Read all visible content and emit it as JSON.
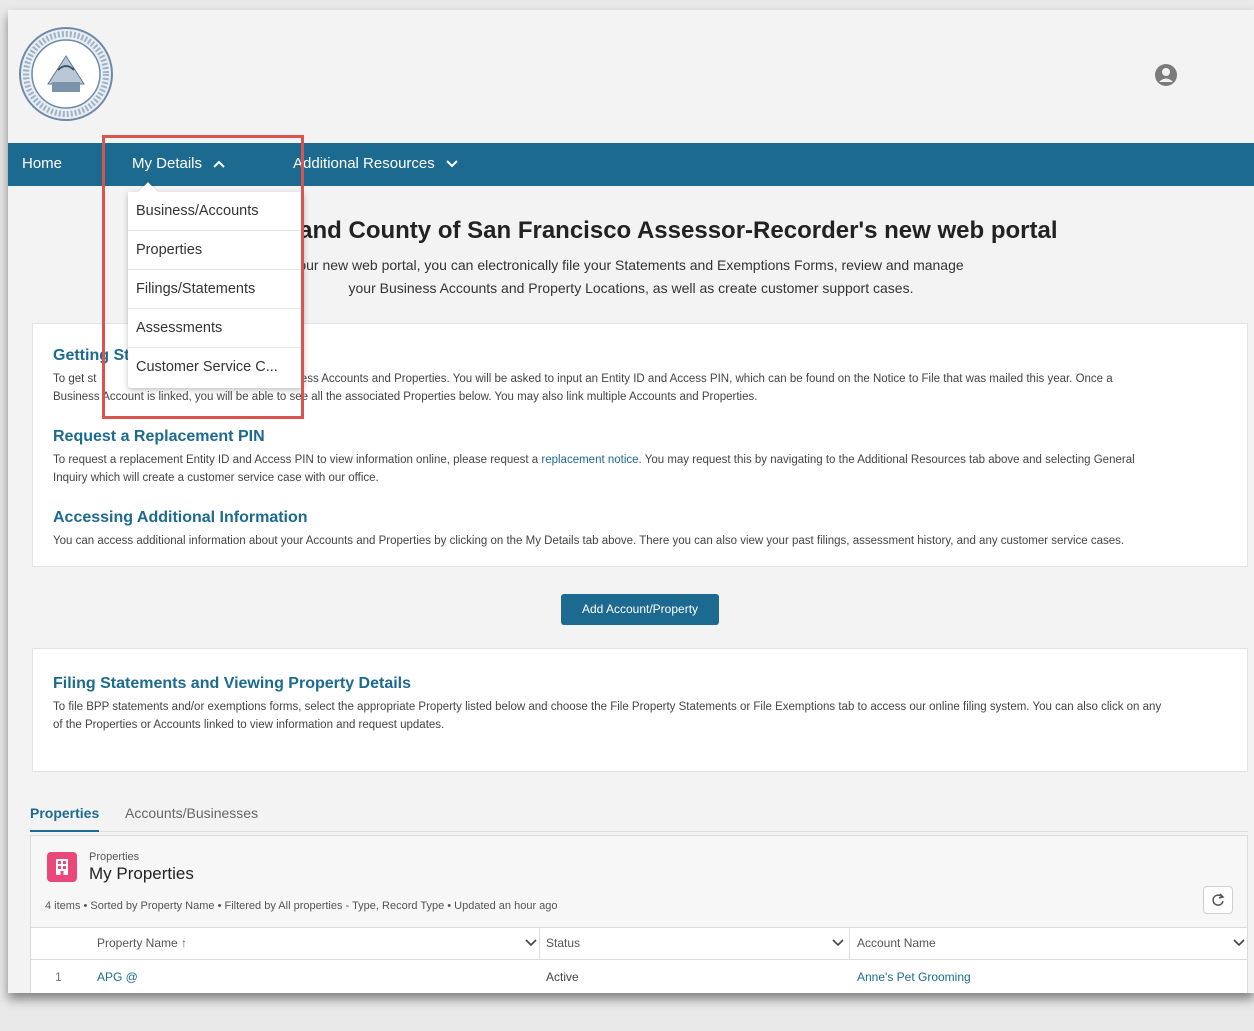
{
  "header": {
    "seal_icon": "city-seal-icon",
    "user_icon": "user-avatar-icon"
  },
  "nav": {
    "home": "Home",
    "my_details": "My Details",
    "additional_resources": "Additional Resources"
  },
  "dropdown": {
    "items": [
      {
        "label": "Business/Accounts"
      },
      {
        "label": "Properties"
      },
      {
        "label": "Filings/Statements"
      },
      {
        "label": "Assessments"
      },
      {
        "label": "Customer Service C..."
      }
    ]
  },
  "welcome": {
    "title": "the City and County of San Francisco Assessor-Recorder's new web portal",
    "line1": "our new web portal, you can electronically file your Statements and Exemptions Forms, review and manage",
    "line2": "your Business Accounts and Property Locations, as well as create customer support cases."
  },
  "info": {
    "getting_started": {
      "heading": "Getting St",
      "body_a": "To get st",
      "body_b": "your Business Accounts and Properties. You will be asked to input an Entity ID and Access PIN, which can be found on the Notice to File that was mailed this year. Once a",
      "body_c": "Business Account is linked, you will be able to see all the associated Properties below. You may also link multiple Accounts and Properties."
    },
    "replacement_pin": {
      "heading": "Request a Replacement PIN",
      "body_pre": "To request a replacement Entity ID and Access PIN to view information online, please request a ",
      "link": "replacement notice",
      "body_post": ". You may request this by navigating to the Additional Resources tab above and selecting General",
      "body_line2": "Inquiry which will create a customer service case with our office."
    },
    "additional_info": {
      "heading": "Accessing Additional Information",
      "body": "You can access additional information about your Accounts and Properties by clicking on the My Details tab above. There you can also view your past filings, assessment history, and any customer service cases."
    }
  },
  "add_button": "Add Account/Property",
  "filing": {
    "heading": "Filing Statements and Viewing Property Details",
    "line1": "To file BPP statements and/or exemptions forms, select the appropriate Property listed below and choose the File Property Statements or File Exemptions tab to access our online filing system. You can also click on any",
    "line2": "of the Properties or Accounts linked to view information and request updates."
  },
  "tabs": [
    {
      "label": "Properties"
    },
    {
      "label": "Accounts/Businesses"
    }
  ],
  "list": {
    "object_label": "Properties",
    "title": "My Properties",
    "meta": "4 items • Sorted by Property Name • Filtered by All properties - Type, Record Type • Updated an hour ago",
    "columns": [
      "Property Name",
      "Status",
      "Account Name"
    ],
    "sort_indicator": "↑",
    "rows": [
      {
        "num": "1",
        "property_name": "APG @",
        "status": "Active",
        "account_name": "Anne's Pet Grooming"
      }
    ]
  },
  "colors": {
    "brand_blue": "#1d6a90",
    "highlight_red": "#d9534f",
    "properties_pink": "#e8487a"
  }
}
